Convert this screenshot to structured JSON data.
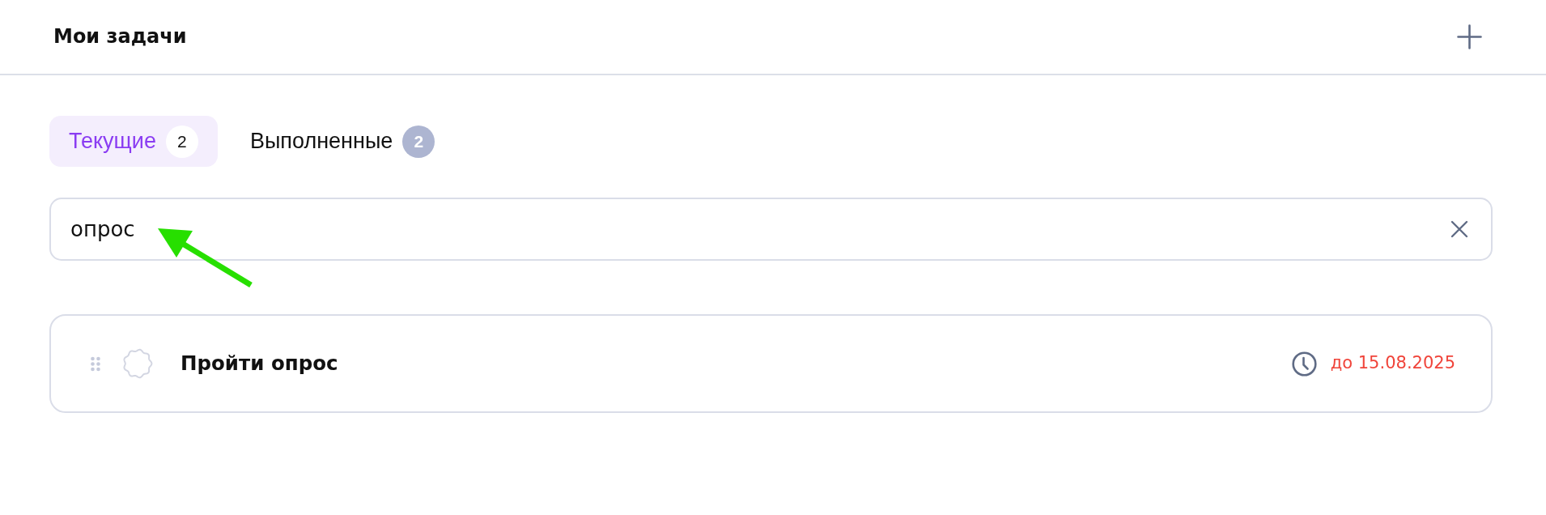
{
  "header": {
    "title": "Мои задачи"
  },
  "tabs": [
    {
      "label": "Текущие",
      "count": "2",
      "selected": true
    },
    {
      "label": "Выполненные",
      "count": "2",
      "selected": false
    }
  ],
  "search": {
    "value": "опрос"
  },
  "tasks": [
    {
      "title": "Пройти опрос",
      "done": false,
      "due": "до 15.08.2025",
      "overdue": true
    }
  ]
}
